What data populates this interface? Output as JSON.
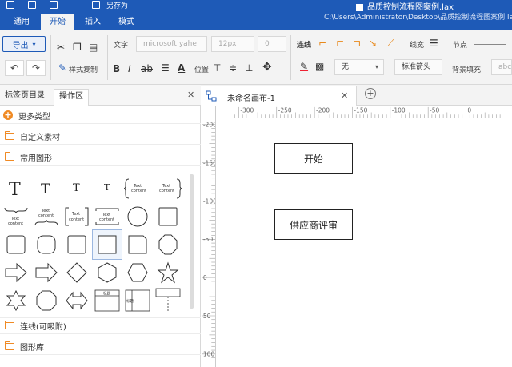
{
  "titlebar": {
    "qa_label": "另存为",
    "doc_title": "品质控制流程图案例.lax"
  },
  "ribbon": {
    "tabs": [
      {
        "label": "通用",
        "active": false
      },
      {
        "label": "开始",
        "active": true
      },
      {
        "label": "插入",
        "active": false
      },
      {
        "label": "模式",
        "active": false
      }
    ],
    "file_path": "C:\\Users\\Administrator\\Desktop\\品质控制流程图案例.lax"
  },
  "toolbar": {
    "export_label": "导出",
    "format_painter_label": "样式复制",
    "text_label": "文字",
    "font_family_value": "microsoft yahe",
    "font_size_value": "12px",
    "letter_spacing_value": "0",
    "position_label": "位置",
    "connector_label": "连线",
    "line_width_label": "线宽",
    "node_label": "节点",
    "arrow_none_value": "无",
    "arrow_style_value": "标准箭头",
    "bg_fill_label": "背景填充",
    "bg_fill_placeholder": "abc"
  },
  "left_panel": {
    "tabs": [
      {
        "label": "标签页目录",
        "active": false
      },
      {
        "label": "操作区",
        "active": true
      }
    ],
    "more_types_label": "更多类型",
    "custom_assets_label": "自定义素材",
    "common_shapes_label": "常用图形",
    "connectors_label": "连线(可吸附)",
    "shape_library_label": "图形库",
    "shape_text_label": "Text content",
    "table_title_label": "标题"
  },
  "document": {
    "tab_label": "未命名画布-1"
  },
  "rulers": {
    "horizontal": [
      "-300",
      "-250",
      "-200",
      "-150",
      "-100",
      "-50",
      "0"
    ],
    "vertical": [
      "-200",
      "-150",
      "-100",
      "-50",
      "0",
      "50",
      "100"
    ]
  },
  "canvas": {
    "nodes": [
      {
        "label": "开始"
      },
      {
        "label": "供应商评审"
      }
    ]
  },
  "colors": {
    "brand": "#1e5ab7",
    "accent": "#f08a24",
    "connector_icon": "#e8891b"
  }
}
